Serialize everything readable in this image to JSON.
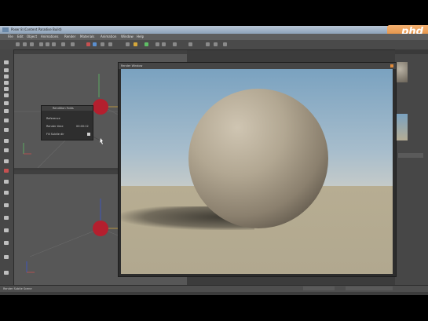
{
  "window": {
    "title": "Poser 8 (Content Paradise Build)"
  },
  "logo": {
    "text": "phd"
  },
  "menu": [
    "File",
    "Edit",
    "Object",
    "Animations",
    "Render",
    "Materials",
    "Animation",
    "Window",
    "Help"
  ],
  "popup": {
    "title": "Rendition Folds",
    "row1": "Reference",
    "row2_label": "Render time",
    "row2_value": "00:00:12",
    "row3": "Fill Subtle dir"
  },
  "render_window": {
    "title": "Render Window"
  },
  "status": {
    "left": "Render Subtle Scene"
  },
  "colors": {
    "accent": "#e08a3a",
    "sky": "#7aa2c0",
    "ground": "#b7ad92"
  }
}
